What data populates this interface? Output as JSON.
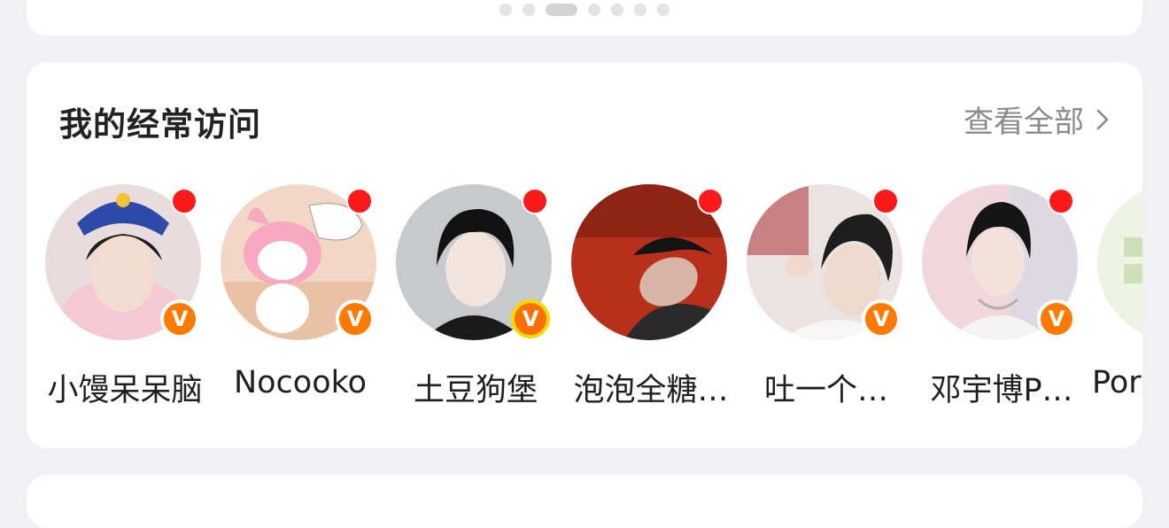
{
  "section": {
    "title": "我的经常访问",
    "view_all_label": "查看全部"
  },
  "visits": [
    {
      "name": "小馒呆呆脑",
      "unread": true,
      "verified": true
    },
    {
      "name": "Nocooko",
      "unread": true,
      "verified": true
    },
    {
      "name": "土豆狗堡",
      "unread": true,
      "verified": true,
      "badge_style": "gold"
    },
    {
      "name": "泡泡全糖…",
      "unread": true,
      "verified": false
    },
    {
      "name": "吐一个…",
      "unread": true,
      "verified": true
    },
    {
      "name": "邓宇博P…",
      "unread": true,
      "verified": true
    },
    {
      "name": "Por",
      "unread": false,
      "verified": false
    }
  ],
  "badge_letter": "V",
  "carousel": {
    "pages": 7,
    "active_index": 2
  },
  "colors": {
    "unread_dot": "#ff1a1a",
    "verified_badge": "#ff7a00",
    "muted_text": "#8a8a8e",
    "background": "#f1f1f3"
  }
}
